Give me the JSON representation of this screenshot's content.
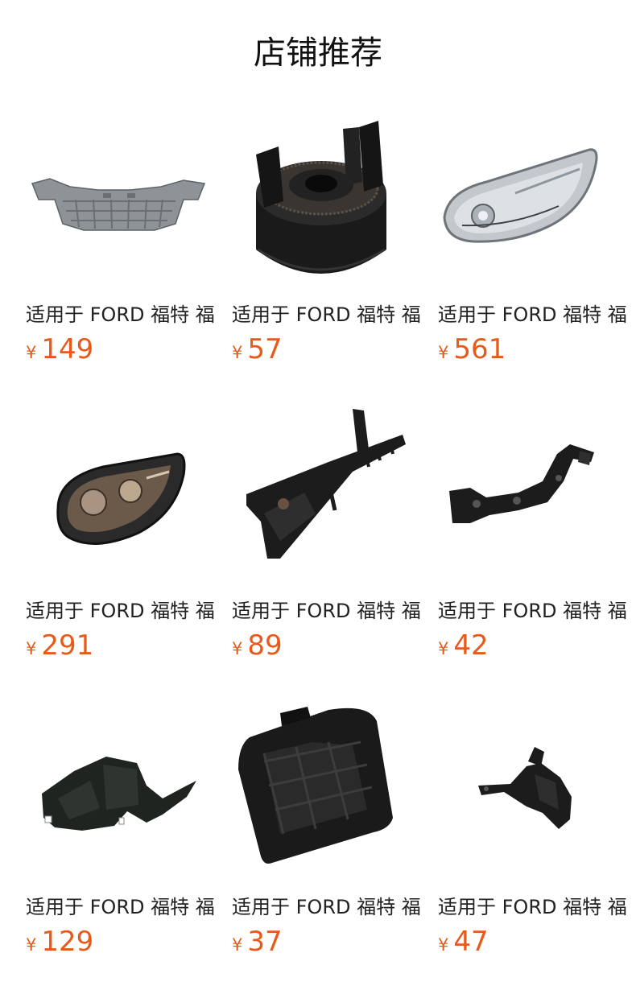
{
  "page": {
    "title": "店铺推荐"
  },
  "products": [
    {
      "title": "适用于 FORD 福特 福",
      "currency": "¥",
      "price": "149",
      "image": "undertray-shield-image",
      "color": "#8a8f94"
    },
    {
      "title": "适用于 FORD 福特 福",
      "currency": "¥",
      "price": "57",
      "image": "gear-hub-part-image",
      "color": "#1a1a1a"
    },
    {
      "title": "适用于 FORD 福特 福",
      "currency": "¥",
      "price": "561",
      "image": "headlight-chrome-image",
      "color": "#b5bcc2"
    },
    {
      "title": "适用于 FORD 福特 福",
      "currency": "¥",
      "price": "291",
      "image": "headlight-black-image",
      "color": "#2a2a2a"
    },
    {
      "title": "适用于 FORD 福特 福",
      "currency": "¥",
      "price": "89",
      "image": "long-bracket-image",
      "color": "#1c1c1c"
    },
    {
      "title": "适用于 FORD 福特 福",
      "currency": "¥",
      "price": "42",
      "image": "curved-bracket-image",
      "color": "#1c1c1c"
    },
    {
      "title": "适用于 FORD 福特 福",
      "currency": "¥",
      "price": "129",
      "image": "fender-liner-image",
      "color": "#1f2421"
    },
    {
      "title": "适用于 FORD 福特 福",
      "currency": "¥",
      "price": "37",
      "image": "grille-cover-image",
      "color": "#1a1a1a"
    },
    {
      "title": "适用于 FORD 福特 福",
      "currency": "¥",
      "price": "47",
      "image": "small-bracket-image",
      "color": "#1c1c1c"
    }
  ],
  "colors": {
    "price": "#e65a1a",
    "text": "#222222",
    "background": "#ffffff"
  }
}
